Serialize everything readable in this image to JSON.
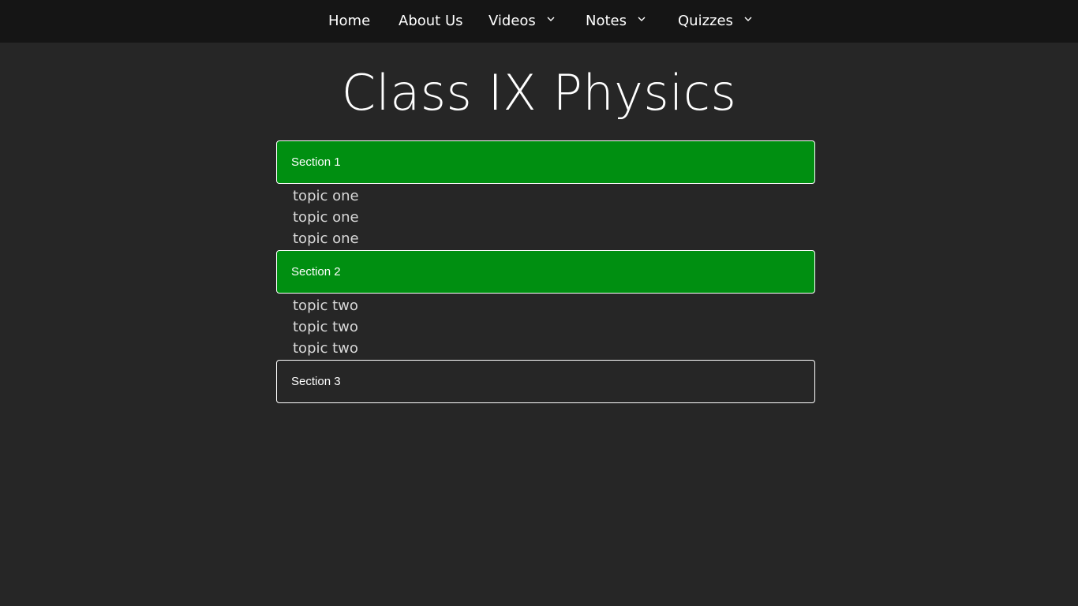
{
  "nav": {
    "items": [
      {
        "label": "Home",
        "dropdown": false
      },
      {
        "label": "About Us",
        "dropdown": false
      },
      {
        "label": "Videos",
        "dropdown": true
      },
      {
        "label": "Notes",
        "dropdown": true
      },
      {
        "label": "Quizzes",
        "dropdown": true
      }
    ]
  },
  "page": {
    "title": "Class IX Physics"
  },
  "accordion": {
    "sections": [
      {
        "label": "Section 1",
        "expanded": true,
        "topics": [
          "topic one",
          "topic one",
          "topic one"
        ]
      },
      {
        "label": "Section 2",
        "expanded": true,
        "topics": [
          "topic two",
          "topic two",
          "topic two"
        ]
      },
      {
        "label": "Section 3",
        "expanded": false,
        "topics": []
      }
    ]
  },
  "colors": {
    "background": "#262626",
    "navbar": "#151515",
    "section_active": "#008f11",
    "text": "#ffffff"
  }
}
